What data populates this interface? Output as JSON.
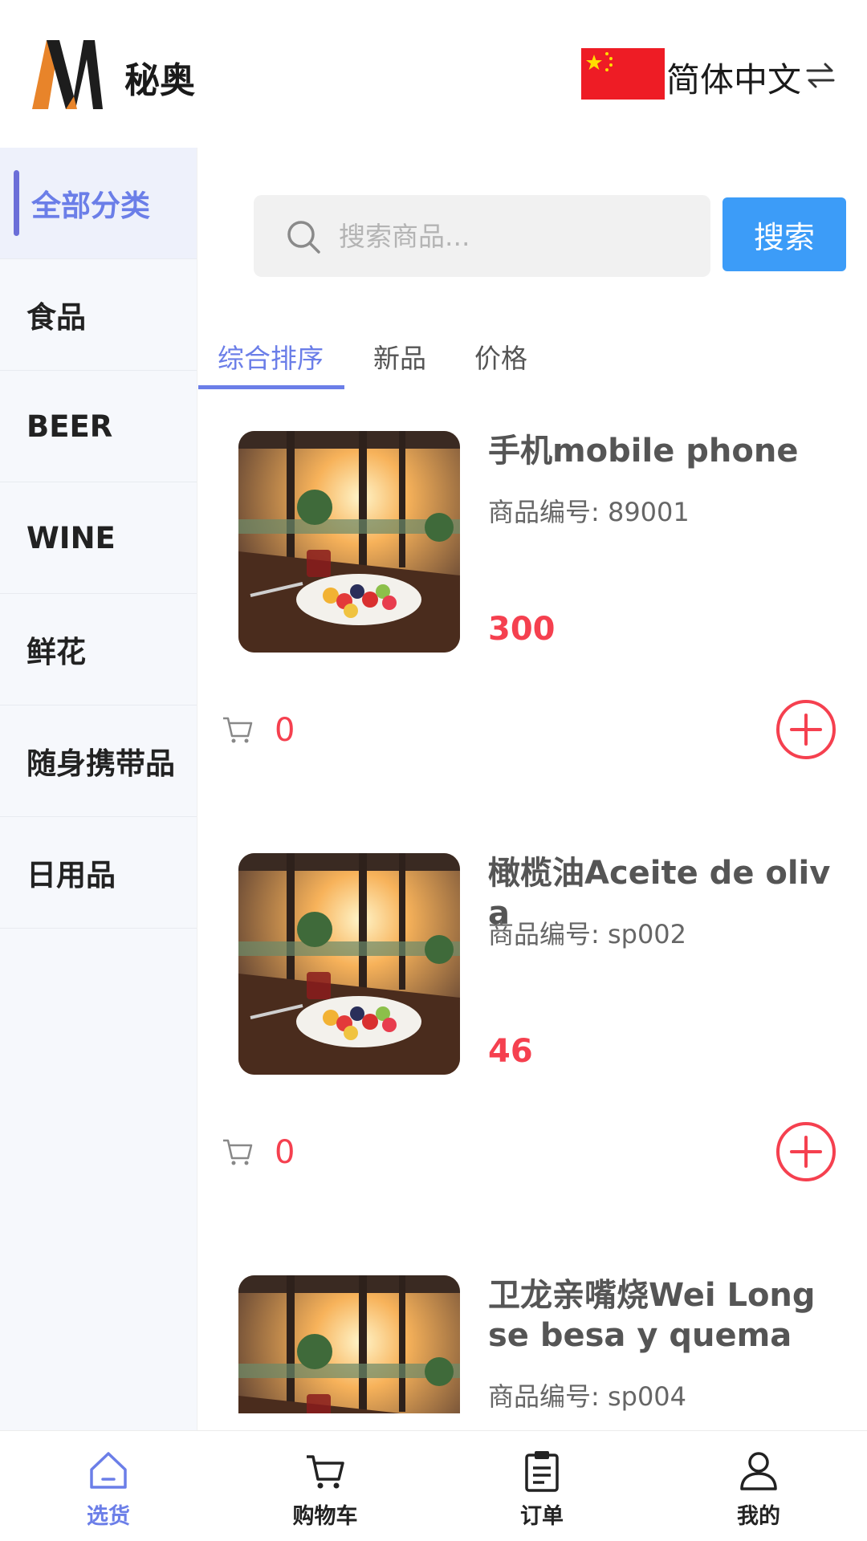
{
  "header": {
    "brand": "秘奥",
    "language": "简体中文"
  },
  "sidebar": {
    "items": [
      {
        "label": "全部分类",
        "active": true
      },
      {
        "label": "食品"
      },
      {
        "label": "BEER"
      },
      {
        "label": "WINE"
      },
      {
        "label": "鲜花"
      },
      {
        "label": "随身携带品"
      },
      {
        "label": "日用品"
      }
    ]
  },
  "search": {
    "placeholder": "搜索商品...",
    "button": "搜索"
  },
  "sort_tabs": [
    {
      "label": "综合排序",
      "active": true
    },
    {
      "label": "新品"
    },
    {
      "label": "价格"
    }
  ],
  "products": [
    {
      "name": "手机mobile phone",
      "code_label": "商品编号: 89001",
      "price": "300",
      "cart_count": "0"
    },
    {
      "name": "橄榄油Aceite de oliva",
      "code_label": "商品编号: sp002",
      "price": "46",
      "cart_count": "0"
    },
    {
      "name": "卫龙亲嘴烧Wei Long se besa y quema",
      "code_label": "商品编号: sp004",
      "price": "",
      "cart_count": ""
    }
  ],
  "bottom_nav": [
    {
      "label": "选货",
      "icon": "home-icon",
      "active": true
    },
    {
      "label": "购物车",
      "icon": "cart-icon"
    },
    {
      "label": "订单",
      "icon": "clipboard-icon"
    },
    {
      "label": "我的",
      "icon": "user-icon"
    }
  ],
  "colors": {
    "accent": "#6b7ee8",
    "search_button": "#3c9cf8",
    "price": "#f5404f",
    "flag": "#ee1c25"
  }
}
